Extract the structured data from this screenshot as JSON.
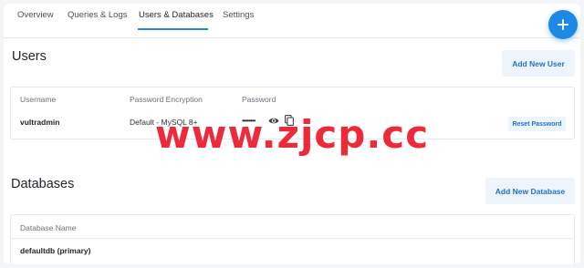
{
  "tabs": [
    {
      "label": "Overview"
    },
    {
      "label": "Queries & Logs"
    },
    {
      "label": "Users & Databases"
    },
    {
      "label": "Settings"
    }
  ],
  "active_tab": "Users & Databases",
  "fab_icon": "plus-icon",
  "users": {
    "title": "Users",
    "add_button": "Add New User",
    "columns": [
      "Username",
      "Password Encryption",
      "Password"
    ],
    "rows": [
      {
        "username": "vultradmin",
        "encryption": "Default - MySQL 8+",
        "password_masked": "••••••••",
        "reset_label": "Reset Password"
      }
    ]
  },
  "databases": {
    "title": "Databases",
    "add_button": "Add New Database",
    "columns": [
      "Database Name"
    ],
    "rows": [
      {
        "name": "defaultdb (primary)"
      }
    ]
  },
  "watermark": "www.zjcp.cc",
  "colors": {
    "accent": "#1e88e5",
    "button_bg": "#eef4fc",
    "button_text": "#1e6fd1",
    "watermark": "#ee2a3a"
  }
}
